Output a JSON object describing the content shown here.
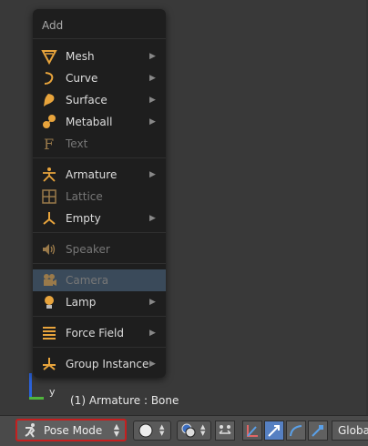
{
  "menu": {
    "title": "Add",
    "items": [
      {
        "label": "Mesh",
        "icon": "mesh-icon",
        "submenu": true
      },
      {
        "label": "Curve",
        "icon": "curve-icon",
        "submenu": true
      },
      {
        "label": "Surface",
        "icon": "surface-icon",
        "submenu": true
      },
      {
        "label": "Metaball",
        "icon": "metaball-icon",
        "submenu": true
      },
      {
        "label": "Text",
        "icon": "text-icon",
        "submenu": false
      },
      {
        "label": "Armature",
        "icon": "armature-icon",
        "submenu": true
      },
      {
        "label": "Lattice",
        "icon": "lattice-icon",
        "submenu": false
      },
      {
        "label": "Empty",
        "icon": "empty-icon",
        "submenu": true
      },
      {
        "label": "Speaker",
        "icon": "speaker-icon",
        "submenu": false
      },
      {
        "label": "Camera",
        "icon": "camera-icon",
        "submenu": false
      },
      {
        "label": "Lamp",
        "icon": "lamp-icon",
        "submenu": true
      },
      {
        "label": "Force Field",
        "icon": "force-field-icon",
        "submenu": true
      },
      {
        "label": "Group Instance",
        "icon": "group-instance-icon",
        "submenu": true
      }
    ]
  },
  "viewport": {
    "overlay_text": "(1) Armature : Bone",
    "axis_label": "y"
  },
  "header": {
    "mode_label": "Pose Mode",
    "orientation_label": "Global"
  },
  "colors": {
    "accent_orange": "#e8a43c",
    "mode_border": "#c51f1f",
    "axis_z": "#2b62d9",
    "axis_y": "#4fb43d"
  }
}
